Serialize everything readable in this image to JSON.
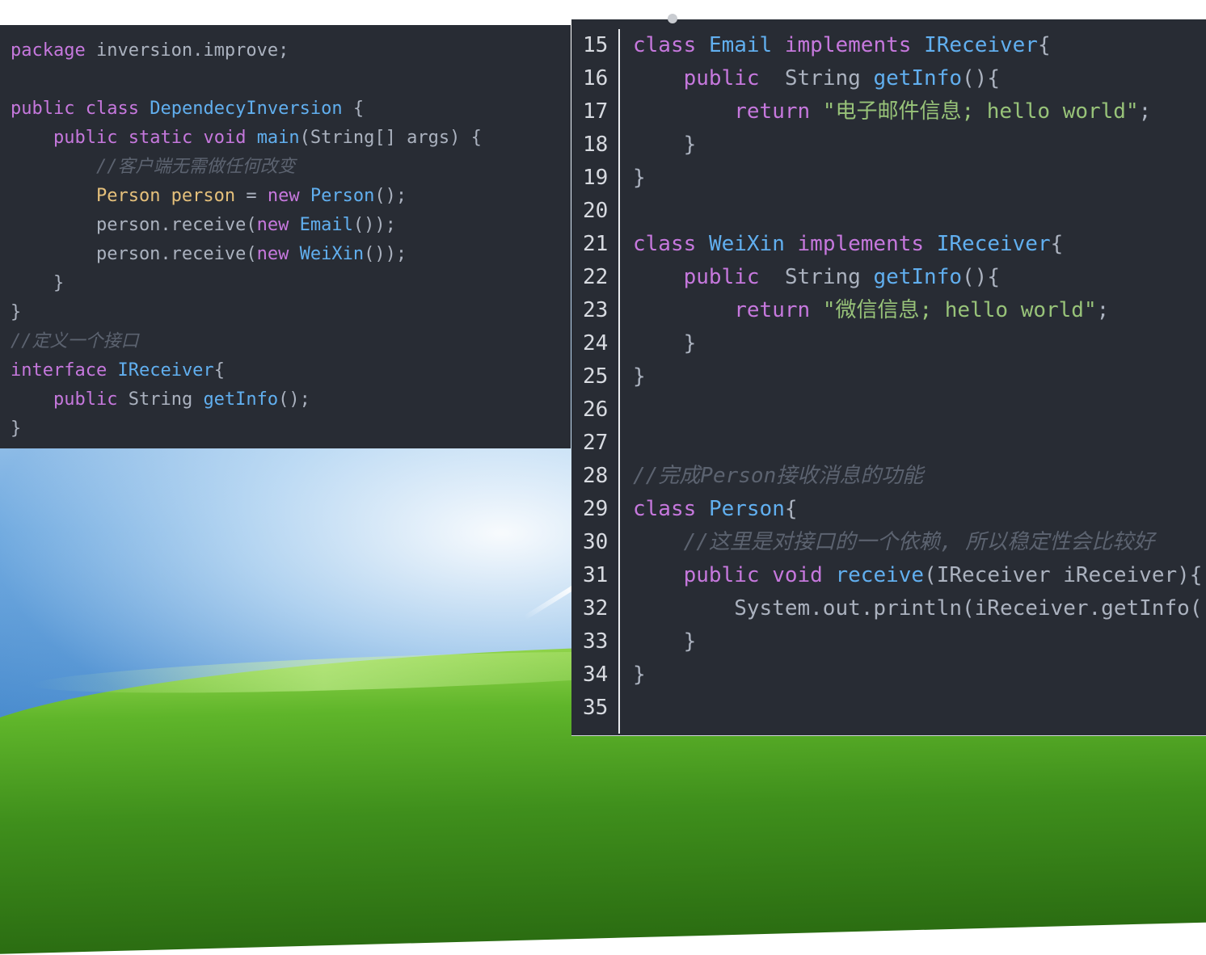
{
  "colors": {
    "panel_bg": "#282c34",
    "keyword": "#c678dd",
    "type": "#61afef",
    "string": "#98c379",
    "comment": "#5c6370",
    "variable": "#e5c07b",
    "plain": "#abb2bf"
  },
  "left_editor": {
    "lines": [
      [
        {
          "t": "package",
          "c": "kw"
        },
        {
          "t": " inversion.improve;",
          "c": "pl"
        }
      ],
      [],
      [
        {
          "t": "public",
          "c": "kw"
        },
        {
          "t": " ",
          "c": "pl"
        },
        {
          "t": "class",
          "c": "kw"
        },
        {
          "t": " ",
          "c": "pl"
        },
        {
          "t": "DependecyInversion",
          "c": "ty"
        },
        {
          "t": " {",
          "c": "pl"
        }
      ],
      [
        {
          "t": "    ",
          "c": "pl"
        },
        {
          "t": "public",
          "c": "kw"
        },
        {
          "t": " ",
          "c": "pl"
        },
        {
          "t": "static",
          "c": "kw"
        },
        {
          "t": " ",
          "c": "pl"
        },
        {
          "t": "void",
          "c": "kw"
        },
        {
          "t": " ",
          "c": "pl"
        },
        {
          "t": "main",
          "c": "fn"
        },
        {
          "t": "(String[] args) {",
          "c": "pl"
        }
      ],
      [
        {
          "t": "        //客户端无需做任何改变",
          "c": "cm"
        }
      ],
      [
        {
          "t": "        ",
          "c": "pl"
        },
        {
          "t": "Person person",
          "c": "va"
        },
        {
          "t": " = ",
          "c": "pl"
        },
        {
          "t": "new",
          "c": "kw"
        },
        {
          "t": " ",
          "c": "pl"
        },
        {
          "t": "Person",
          "c": "ty"
        },
        {
          "t": "();",
          "c": "pl"
        }
      ],
      [
        {
          "t": "        person.receive(",
          "c": "pl"
        },
        {
          "t": "new",
          "c": "kw"
        },
        {
          "t": " ",
          "c": "pl"
        },
        {
          "t": "Email",
          "c": "ty"
        },
        {
          "t": "());",
          "c": "pl"
        }
      ],
      [
        {
          "t": "        person.receive(",
          "c": "pl"
        },
        {
          "t": "new",
          "c": "kw"
        },
        {
          "t": " ",
          "c": "pl"
        },
        {
          "t": "WeiXin",
          "c": "ty"
        },
        {
          "t": "());",
          "c": "pl"
        }
      ],
      [
        {
          "t": "    }",
          "c": "pl"
        }
      ],
      [
        {
          "t": "}",
          "c": "pl"
        }
      ],
      [
        {
          "t": "//定义一个接口",
          "c": "cm"
        }
      ],
      [
        {
          "t": "interface",
          "c": "kw"
        },
        {
          "t": " ",
          "c": "pl"
        },
        {
          "t": "IReceiver",
          "c": "ty"
        },
        {
          "t": "{",
          "c": "pl"
        }
      ],
      [
        {
          "t": "    ",
          "c": "pl"
        },
        {
          "t": "public",
          "c": "kw"
        },
        {
          "t": " String ",
          "c": "pl"
        },
        {
          "t": "getInfo",
          "c": "fn"
        },
        {
          "t": "();",
          "c": "pl"
        }
      ],
      [
        {
          "t": "}",
          "c": "pl"
        }
      ]
    ]
  },
  "right_editor": {
    "lines": [
      {
        "n": "15",
        "tokens": [
          {
            "t": "class",
            "c": "kw"
          },
          {
            "t": " ",
            "c": "pl"
          },
          {
            "t": "Email",
            "c": "ty"
          },
          {
            "t": " ",
            "c": "pl"
          },
          {
            "t": "implements",
            "c": "kw"
          },
          {
            "t": " ",
            "c": "pl"
          },
          {
            "t": "IReceiver",
            "c": "ty"
          },
          {
            "t": "{",
            "c": "pl"
          }
        ]
      },
      {
        "n": "16",
        "tokens": [
          {
            "t": "    ",
            "c": "pl"
          },
          {
            "t": "public",
            "c": "kw"
          },
          {
            "t": "  String ",
            "c": "pl"
          },
          {
            "t": "getInfo",
            "c": "fn"
          },
          {
            "t": "(){",
            "c": "pl"
          }
        ]
      },
      {
        "n": "17",
        "tokens": [
          {
            "t": "        ",
            "c": "pl"
          },
          {
            "t": "return",
            "c": "kw"
          },
          {
            "t": " ",
            "c": "pl"
          },
          {
            "t": "\"电子邮件信息; hello world\"",
            "c": "st"
          },
          {
            "t": ";",
            "c": "pl"
          }
        ]
      },
      {
        "n": "18",
        "tokens": [
          {
            "t": "    }",
            "c": "pl"
          }
        ]
      },
      {
        "n": "19",
        "tokens": [
          {
            "t": "}",
            "c": "pl"
          }
        ]
      },
      {
        "n": "20",
        "tokens": []
      },
      {
        "n": "21",
        "tokens": [
          {
            "t": "class",
            "c": "kw"
          },
          {
            "t": " ",
            "c": "pl"
          },
          {
            "t": "WeiXin",
            "c": "ty"
          },
          {
            "t": " ",
            "c": "pl"
          },
          {
            "t": "implements",
            "c": "kw"
          },
          {
            "t": " ",
            "c": "pl"
          },
          {
            "t": "IReceiver",
            "c": "ty"
          },
          {
            "t": "{",
            "c": "pl"
          }
        ]
      },
      {
        "n": "22",
        "tokens": [
          {
            "t": "    ",
            "c": "pl"
          },
          {
            "t": "public",
            "c": "kw"
          },
          {
            "t": "  String ",
            "c": "pl"
          },
          {
            "t": "getInfo",
            "c": "fn"
          },
          {
            "t": "(){",
            "c": "pl"
          }
        ]
      },
      {
        "n": "23",
        "tokens": [
          {
            "t": "        ",
            "c": "pl"
          },
          {
            "t": "return",
            "c": "kw"
          },
          {
            "t": " ",
            "c": "pl"
          },
          {
            "t": "\"微信信息; hello world\"",
            "c": "st"
          },
          {
            "t": ";",
            "c": "pl"
          }
        ]
      },
      {
        "n": "24",
        "tokens": [
          {
            "t": "    }",
            "c": "pl"
          }
        ]
      },
      {
        "n": "25",
        "tokens": [
          {
            "t": "}",
            "c": "pl"
          }
        ]
      },
      {
        "n": "26",
        "tokens": []
      },
      {
        "n": "27",
        "tokens": []
      },
      {
        "n": "28",
        "tokens": [
          {
            "t": "//完成Person接收消息的功能",
            "c": "cm"
          }
        ]
      },
      {
        "n": "29",
        "tokens": [
          {
            "t": "class",
            "c": "kw"
          },
          {
            "t": " ",
            "c": "pl"
          },
          {
            "t": "Person",
            "c": "ty"
          },
          {
            "t": "{",
            "c": "pl"
          }
        ]
      },
      {
        "n": "30",
        "tokens": [
          {
            "t": "    ",
            "c": "pl"
          },
          {
            "t": "//这里是对接口的一个依赖, 所以稳定性会比较好",
            "c": "cm"
          }
        ]
      },
      {
        "n": "31",
        "tokens": [
          {
            "t": "    ",
            "c": "pl"
          },
          {
            "t": "public",
            "c": "kw"
          },
          {
            "t": " ",
            "c": "pl"
          },
          {
            "t": "void",
            "c": "kw"
          },
          {
            "t": " ",
            "c": "pl"
          },
          {
            "t": "receive",
            "c": "fn"
          },
          {
            "t": "(IReceiver iReceiver){",
            "c": "pl"
          }
        ]
      },
      {
        "n": "32",
        "tokens": [
          {
            "t": "        System.out.println(iReceiver.getInfo(",
            "c": "pl"
          }
        ]
      },
      {
        "n": "33",
        "tokens": [
          {
            "t": "    }",
            "c": "pl"
          }
        ]
      },
      {
        "n": "34",
        "tokens": [
          {
            "t": "}",
            "c": "pl"
          }
        ]
      },
      {
        "n": "35",
        "tokens": []
      }
    ]
  }
}
